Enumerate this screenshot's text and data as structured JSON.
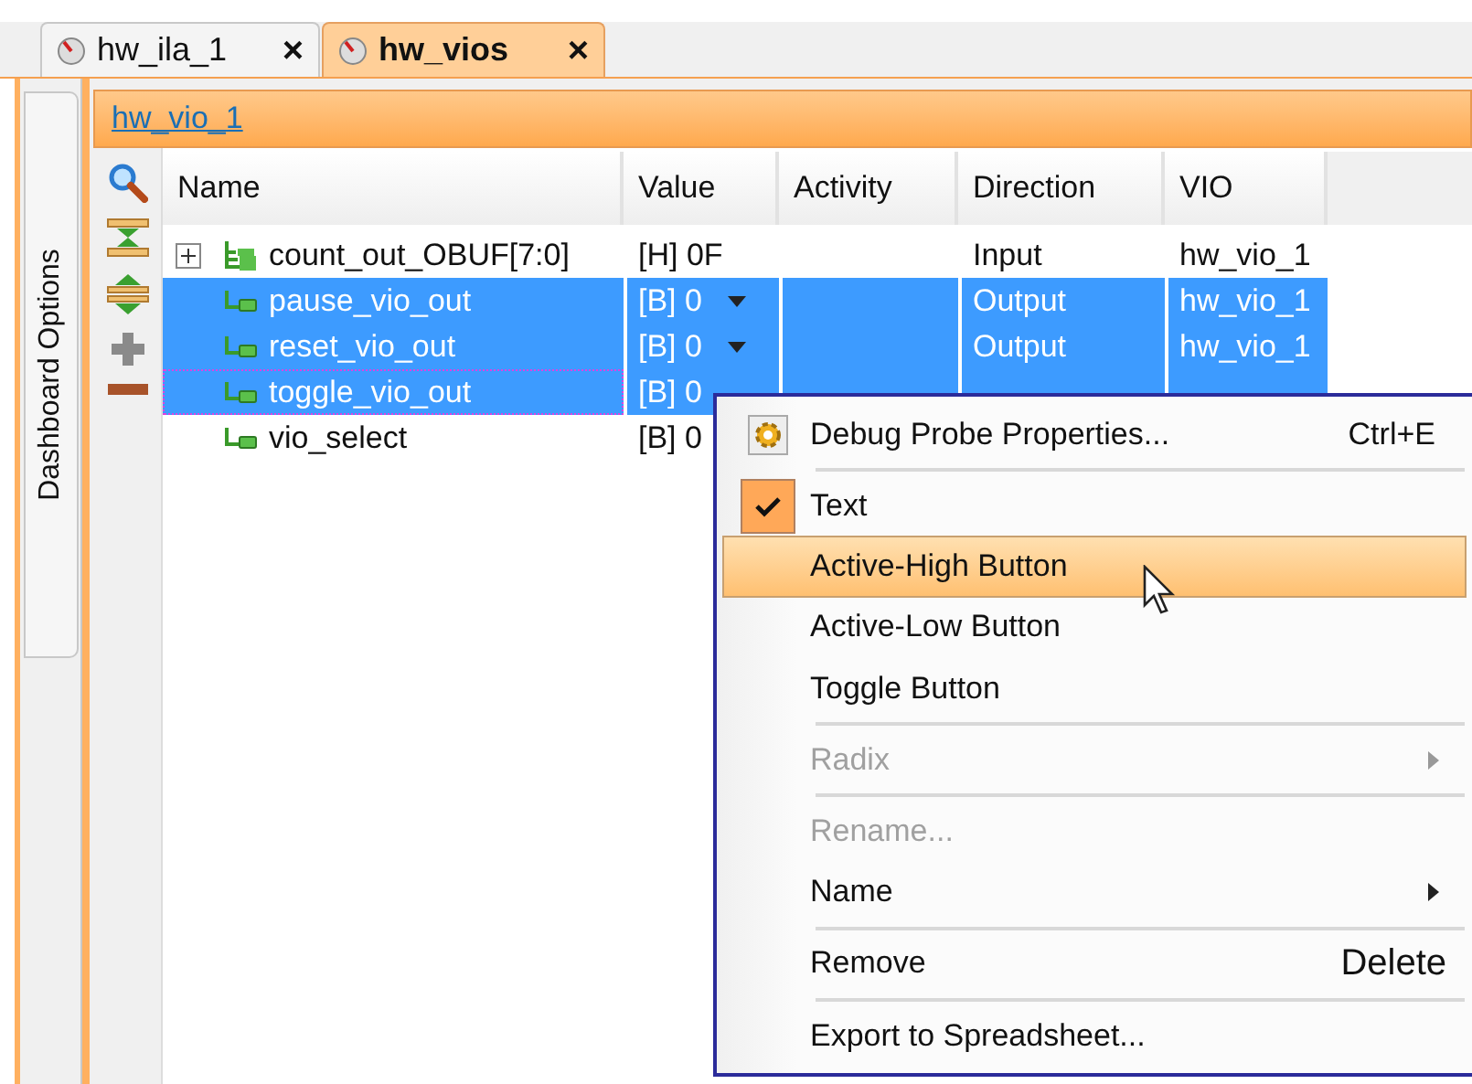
{
  "tabs": [
    {
      "label": "hw_ila_1",
      "selected": false,
      "close": "×"
    },
    {
      "label": "hw_vios",
      "selected": true,
      "close": "×"
    }
  ],
  "side_tab": {
    "label": "Dashboard Options"
  },
  "panel": {
    "title": "hw_vio_1"
  },
  "table": {
    "columns": [
      "Name",
      "Value",
      "Activity",
      "Direction",
      "VIO"
    ],
    "rows": [
      {
        "kind": "bus",
        "expanded": false,
        "name": "count_out_OBUF[7:0]",
        "value": "[H] 0F",
        "dropdown": false,
        "direction": "Input",
        "vio": "hw_vio_1",
        "selected": false,
        "focused": false
      },
      {
        "kind": "signal",
        "name": "pause_vio_out",
        "value": "[B] 0",
        "dropdown": true,
        "direction": "Output",
        "vio": "hw_vio_1",
        "selected": true,
        "focused": false
      },
      {
        "kind": "signal",
        "name": "reset_vio_out",
        "value": "[B] 0",
        "dropdown": true,
        "direction": "Output",
        "vio": "hw_vio_1",
        "selected": true,
        "focused": false
      },
      {
        "kind": "signal",
        "name": "toggle_vio_out",
        "value": "[B] 0",
        "dropdown": false,
        "selected": true,
        "focused": true
      },
      {
        "kind": "signal",
        "name": "vio_select",
        "value": "[B] 0",
        "dropdown": false,
        "selected": false,
        "focused": false
      }
    ]
  },
  "context_menu": {
    "items": [
      {
        "kind": "properties",
        "label": "Debug Probe Properties...",
        "shortcut": "Ctrl+E",
        "checked": false,
        "selected": false,
        "disabled": false,
        "submenu": false,
        "separator_after": true
      },
      {
        "kind": "plain",
        "label": "Text",
        "checked": true,
        "selected": false,
        "disabled": false,
        "submenu": false,
        "separator_after": false
      },
      {
        "kind": "plain",
        "label": "Active-High Button",
        "checked": false,
        "selected": true,
        "disabled": false,
        "submenu": false,
        "separator_after": false
      },
      {
        "kind": "plain",
        "label": "Active-Low Button",
        "checked": false,
        "selected": false,
        "disabled": false,
        "submenu": false,
        "separator_after": false
      },
      {
        "kind": "plain",
        "label": "Toggle Button",
        "checked": false,
        "selected": false,
        "disabled": false,
        "submenu": false,
        "separator_after": true
      },
      {
        "kind": "plain",
        "label": "Radix",
        "checked": false,
        "selected": false,
        "disabled": true,
        "submenu": true,
        "separator_after": true
      },
      {
        "kind": "plain",
        "label": "Rename...",
        "checked": false,
        "selected": false,
        "disabled": true,
        "submenu": false,
        "separator_after": false
      },
      {
        "kind": "plain",
        "label": "Name",
        "checked": false,
        "selected": false,
        "disabled": false,
        "submenu": true,
        "separator_after": true
      },
      {
        "kind": "plain",
        "label": "Remove",
        "shortcut": "Delete",
        "checked": false,
        "selected": false,
        "disabled": false,
        "submenu": false,
        "separator_after": true
      },
      {
        "kind": "plain",
        "label": "Export to Spreadsheet...",
        "checked": false,
        "selected": false,
        "disabled": false,
        "submenu": false,
        "separator_after": false
      }
    ]
  }
}
